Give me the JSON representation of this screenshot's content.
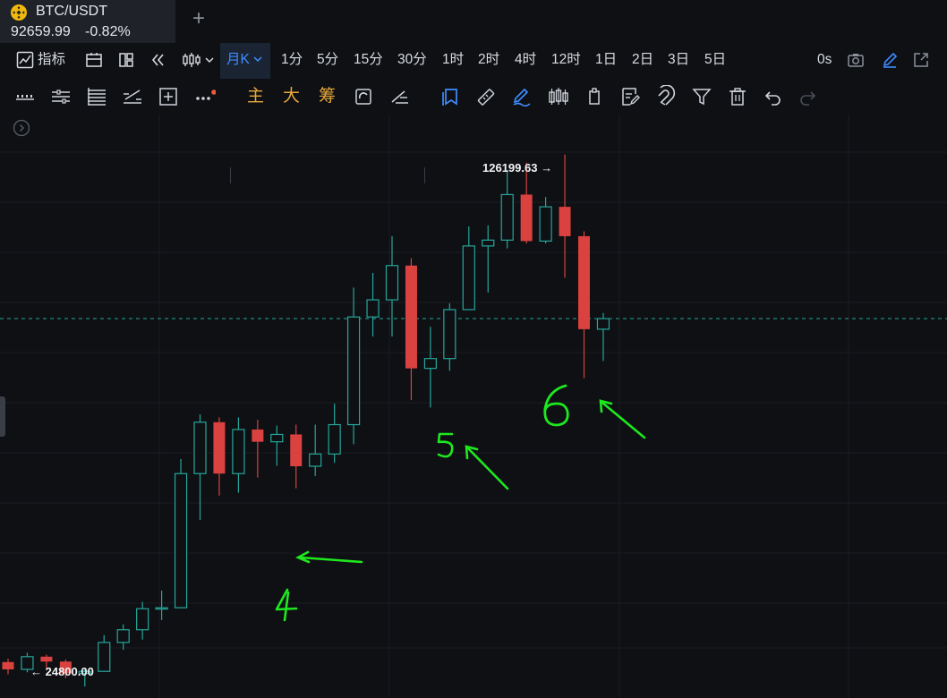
{
  "tab": {
    "symbol": "BTC/USDT",
    "price": "92659.99",
    "change": "-0.82%",
    "add_label": "+"
  },
  "toolbar": {
    "indicators_label": "指标",
    "active_interval": "月K",
    "intervals": [
      "1分",
      "5分",
      "15分",
      "30分",
      "1时",
      "2时",
      "4时",
      "12时",
      "1日",
      "2日",
      "3日",
      "5日"
    ],
    "countdown": "0s"
  },
  "drawing_toolbar": {
    "main_label": "主",
    "big_label": "大",
    "chips_label": "筹",
    "tools": [
      "horizontal-lines-icon",
      "parallel-lines-icon",
      "fib-lines-icon",
      "measure-icon",
      "add-box-icon",
      "more-icon",
      "copy-icon",
      "ruler-icon",
      "pencil-icon",
      "candles-icon",
      "note-icon",
      "text-icon",
      "magnet-icon",
      "filter-icon",
      "trash-icon",
      "undo-icon",
      "redo-icon"
    ]
  },
  "chart": {
    "high_label": "126199.63 →",
    "low_label": "← 24800.00",
    "current_price": 92659.99,
    "up_color": "#26a69a",
    "down_color": "#d9423f",
    "annotations": [
      "4",
      "5",
      "6"
    ]
  },
  "chart_data": {
    "type": "candlestick",
    "interval": "月K",
    "high": 126199.63,
    "low": 24800.0,
    "candles": [
      {
        "o": 22.5,
        "c": 21.0,
        "h": 23.2,
        "l": 20.0
      },
      {
        "o": 21.0,
        "c": 23.6,
        "h": 24.4,
        "l": 20.4
      },
      {
        "o": 23.6,
        "c": 22.6,
        "h": 24.0,
        "l": 21.2
      },
      {
        "o": 22.6,
        "c": 20.2,
        "h": 23.0,
        "l": 19.2
      },
      {
        "o": 20.2,
        "c": 20.6,
        "h": 21.0,
        "l": 17.5
      },
      {
        "o": 20.6,
        "c": 26.5,
        "h": 28.0,
        "l": 20.6
      },
      {
        "o": 26.5,
        "c": 29.1,
        "h": 30.2,
        "l": 25.0
      },
      {
        "o": 29.1,
        "c": 33.4,
        "h": 34.8,
        "l": 27.1
      },
      {
        "o": 33.4,
        "c": 33.6,
        "h": 37.1,
        "l": 31.1
      },
      {
        "o": 33.6,
        "c": 61.0,
        "h": 64.0,
        "l": 33.6
      },
      {
        "o": 61.0,
        "c": 71.5,
        "h": 73.1,
        "l": 51.5
      },
      {
        "o": 71.5,
        "c": 61.0,
        "h": 72.5,
        "l": 56.5
      },
      {
        "o": 61.0,
        "c": 70.0,
        "h": 72.5,
        "l": 57.1
      },
      {
        "o": 70.0,
        "c": 67.5,
        "h": 72.0,
        "l": 60.2
      },
      {
        "o": 67.5,
        "c": 69.0,
        "h": 70.8,
        "l": 62.6
      },
      {
        "o": 69.0,
        "c": 62.5,
        "h": 71.0,
        "l": 58.0
      },
      {
        "o": 62.5,
        "c": 65.0,
        "h": 71.0,
        "l": 60.5
      },
      {
        "o": 65.0,
        "c": 71.0,
        "h": 75.3,
        "l": 63.2
      },
      {
        "o": 71.0,
        "c": 93.0,
        "h": 99.0,
        "l": 67.0
      },
      {
        "o": 93.0,
        "c": 96.5,
        "h": 102.0,
        "l": 89.0
      },
      {
        "o": 96.5,
        "c": 103.5,
        "h": 109.5,
        "l": 89.0
      },
      {
        "o": 103.5,
        "c": 82.5,
        "h": 105.0,
        "l": 76.0
      },
      {
        "o": 82.5,
        "c": 84.5,
        "h": 91.0,
        "l": 74.5
      },
      {
        "o": 84.5,
        "c": 94.5,
        "h": 95.8,
        "l": 82.0
      },
      {
        "o": 94.5,
        "c": 107.5,
        "h": 111.5,
        "l": 94.5
      },
      {
        "o": 107.5,
        "c": 108.7,
        "h": 111.7,
        "l": 98.0
      },
      {
        "o": 108.7,
        "c": 118.0,
        "h": 123.0,
        "l": 107.0
      },
      {
        "o": 118.0,
        "c": 108.5,
        "h": 124.5,
        "l": 108.0
      },
      {
        "o": 108.5,
        "c": 115.5,
        "h": 117.5,
        "l": 108.0
      },
      {
        "o": 115.5,
        "c": 109.5,
        "h": 126.2,
        "l": 101.0
      },
      {
        "o": 109.5,
        "c": 90.5,
        "h": 110.5,
        "l": 80.5
      },
      {
        "o": 90.5,
        "c": 92.66,
        "h": 93.8,
        "l": 84.0
      }
    ]
  }
}
